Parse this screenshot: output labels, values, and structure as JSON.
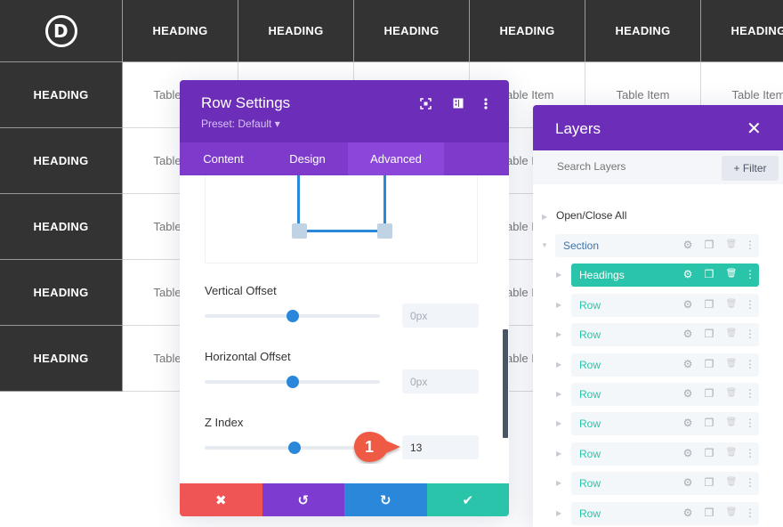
{
  "table": {
    "logo_letter": "D",
    "header_row": [
      "HEADING",
      "HEADING",
      "HEADING",
      "HEADING",
      "HEADING",
      "HEADING"
    ],
    "row_headings": [
      "HEADING",
      "HEADING",
      "HEADING",
      "HEADING",
      "HEADING"
    ],
    "cell_text": "Table Item"
  },
  "row_settings": {
    "title": "Row Settings",
    "preset": "Preset: Default ▾",
    "header_icons": [
      "focus-icon",
      "split-view-icon",
      "more-vertical-icon"
    ],
    "tabs": [
      {
        "label": "Content",
        "active": false
      },
      {
        "label": "Design",
        "active": false
      },
      {
        "label": "Advanced",
        "active": true
      }
    ],
    "fields": [
      {
        "label": "Vertical Offset",
        "value": "0px",
        "placeholder": true,
        "slider_fraction": 0.5
      },
      {
        "label": "Horizontal Offset",
        "value": "0px",
        "placeholder": true,
        "slider_fraction": 0.5
      },
      {
        "label": "Z Index",
        "value": "13",
        "placeholder": false,
        "slider_fraction": 0.515
      }
    ],
    "footer": [
      {
        "name": "discard-button",
        "glyph": "✖",
        "color": "#ef5555"
      },
      {
        "name": "undo-button",
        "glyph": "↺",
        "color": "#7e3bd0"
      },
      {
        "name": "redo-button",
        "glyph": "↻",
        "color": "#2b87da"
      },
      {
        "name": "save-button",
        "glyph": "✔",
        "color": "#29c4a9"
      }
    ]
  },
  "callout": {
    "number": "1",
    "color": "#ef5a45"
  },
  "layers": {
    "title": "Layers",
    "close_glyph": "✕",
    "search_placeholder": "Search Layers",
    "filter_label": "+ Filter",
    "open_close_all": "Open/Close All",
    "items": [
      {
        "label": "Section",
        "type": "section",
        "active": false
      },
      {
        "label": "Headings",
        "type": "row",
        "active": true
      },
      {
        "label": "Row",
        "type": "row",
        "active": false
      },
      {
        "label": "Row",
        "type": "row",
        "active": false
      },
      {
        "label": "Row",
        "type": "row",
        "active": false
      },
      {
        "label": "Row",
        "type": "row",
        "active": false
      },
      {
        "label": "Row",
        "type": "row",
        "active": false
      },
      {
        "label": "Row",
        "type": "row",
        "active": false
      },
      {
        "label": "Row",
        "type": "row",
        "active": false
      },
      {
        "label": "Row",
        "type": "row",
        "active": false
      }
    ]
  },
  "colors": {
    "purple": "#6c2eb9",
    "tab_bar": "#7d3acb",
    "tab_active": "#8b46da",
    "blue": "#2b87da",
    "teal": "#29c4a9",
    "table_dark": "#333333"
  }
}
